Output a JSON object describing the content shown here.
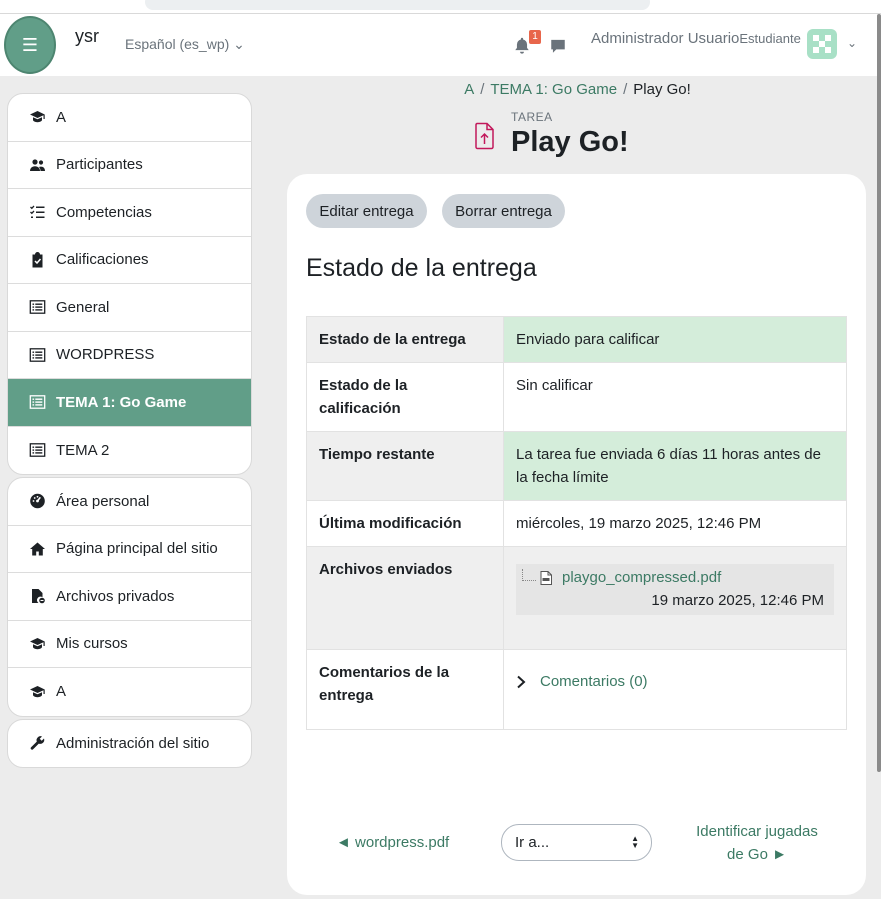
{
  "navbar": {
    "site_name": "ysr",
    "language": "Español (es_wp)",
    "notification_count": "1",
    "user_name": "Administrador Usuario",
    "user_role": "Estudiante"
  },
  "sidebar": {
    "course_items": [
      {
        "label": "A",
        "icon": "graduation-cap-icon"
      },
      {
        "label": "Participantes",
        "icon": "users-icon"
      },
      {
        "label": "Competencias",
        "icon": "checklist-icon"
      },
      {
        "label": "Calificaciones",
        "icon": "clipboard-check-icon"
      },
      {
        "label": "General",
        "icon": "section-icon"
      },
      {
        "label": "WORDPRESS",
        "icon": "section-icon"
      },
      {
        "label": "TEMA 1: Go Game",
        "icon": "section-icon"
      },
      {
        "label": "TEMA 2",
        "icon": "section-icon"
      }
    ],
    "site_items": [
      {
        "label": "Área personal",
        "icon": "dashboard-icon"
      },
      {
        "label": "Página principal del sitio",
        "icon": "home-icon"
      },
      {
        "label": "Archivos privados",
        "icon": "file-icon"
      },
      {
        "label": "Mis cursos",
        "icon": "graduation-cap-icon"
      },
      {
        "label": "A",
        "icon": "graduation-cap-icon"
      }
    ],
    "admin_item": {
      "label": "Administración del sitio",
      "icon": "wrench-icon"
    }
  },
  "breadcrumb": {
    "items": [
      "A",
      "TEMA 1: Go Game",
      "Play Go!"
    ]
  },
  "activity": {
    "type": "TAREA",
    "title": "Play Go!"
  },
  "actions": {
    "edit": "Editar entrega",
    "delete": "Borrar entrega"
  },
  "submission": {
    "heading": "Estado de la entrega",
    "rows": {
      "status_label": "Estado de la entrega",
      "status_value": "Enviado para calificar",
      "grading_label": "Estado de la calificación",
      "grading_value": "Sin calificar",
      "time_label": "Tiempo restante",
      "time_value": "La tarea fue enviada 6 días 11 horas antes de la fecha límite",
      "modified_label": "Última modificación",
      "modified_value": "miércoles, 19 marzo 2025, 12:46 PM",
      "files_label": "Archivos enviados",
      "file_name": "playgo_compressed.pdf",
      "file_date": "19 marzo 2025, 12:46 PM",
      "comments_label": "Comentarios de la entrega",
      "comments_link": "Comentarios (0)"
    }
  },
  "pager": {
    "prev": "◄ wordpress.pdf",
    "jump": "Ir a...",
    "next": "Identificar jugadas de Go ►"
  },
  "colors": {
    "brand": "#619e88",
    "link": "#3c7a64",
    "success_bg": "#d4edda"
  }
}
